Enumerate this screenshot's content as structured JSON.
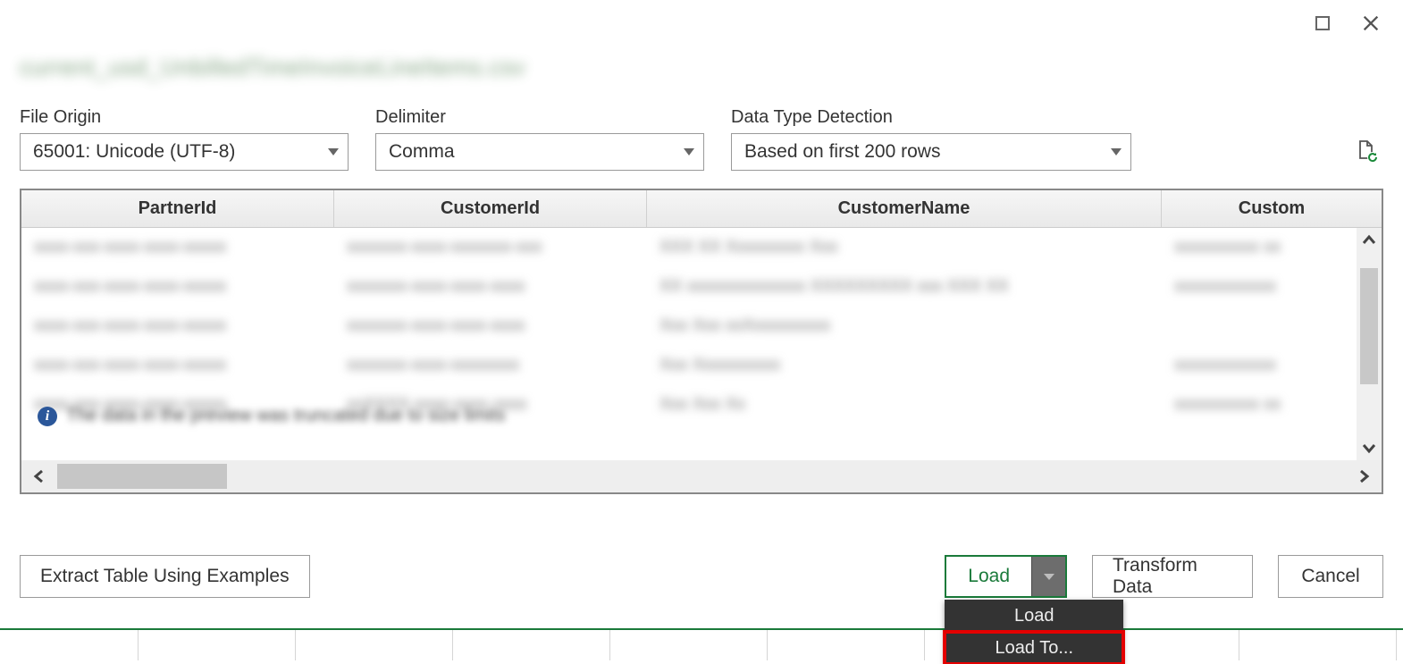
{
  "window": {
    "title_blurred": "current_usd_UnbilledTimeInvoiceLineItems.csv"
  },
  "options": {
    "file_origin": {
      "label": "File Origin",
      "value": "65001: Unicode (UTF-8)"
    },
    "delimiter": {
      "label": "Delimiter",
      "value": "Comma"
    },
    "detection": {
      "label": "Data Type Detection",
      "value": "Based on first 200 rows"
    }
  },
  "grid": {
    "columns": [
      "PartnerId",
      "CustomerId",
      "CustomerName",
      "Custom"
    ],
    "rows": [
      {
        "c1": "xxxx-xxx-xxxx-xxxx-xxxxx",
        "c2": "xxxxxxx-xxxx-xxxxxxx-xxx",
        "c3": "XXX XX Xxxxxxxxx Xxx",
        "c4": "xxxxxxxxxx xx"
      },
      {
        "c1": "xxxx-xxx-xxxx-xxxx-xxxxx",
        "c2": "xxxxxxx-xxxx-xxxx-xxxx",
        "c3": "XX xxxxxxxxxxxxxx XXXXXXXXX xxx XXX XX",
        "c4": "xxxxxxxxxxxx"
      },
      {
        "c1": "xxxx-xxx-xxxx-xxxx-xxxxx",
        "c2": "xxxxxxx-xxxx-xxxx-xxxx",
        "c3": "Xxx  Xxx  xxXxxxxxxxxx",
        "c4": ""
      },
      {
        "c1": "xxxx-xxx-xxxx-xxxx-xxxxx",
        "c2": "xxxxxxx-xxxx-xxxxxxxx",
        "c3": "Xxx  Xxxxxxxxxx",
        "c4": "xxxxxxxxxxxx"
      },
      {
        "c1": "xxxx-xxx-xxxx-xxxx-xxxxx",
        "c2": "xxXXXX-xxxx-xxxx xxxx",
        "c3": "Xxx Xxx Xx",
        "c4": "xxxxxxxxxx xx"
      }
    ],
    "info_truncated": "The data in the preview was truncated due to size limits"
  },
  "buttons": {
    "extract": "Extract Table Using Examples",
    "load": "Load",
    "transform": "Transform Data",
    "cancel": "Cancel"
  },
  "load_menu": {
    "item1": "Load",
    "item2": "Load To..."
  }
}
